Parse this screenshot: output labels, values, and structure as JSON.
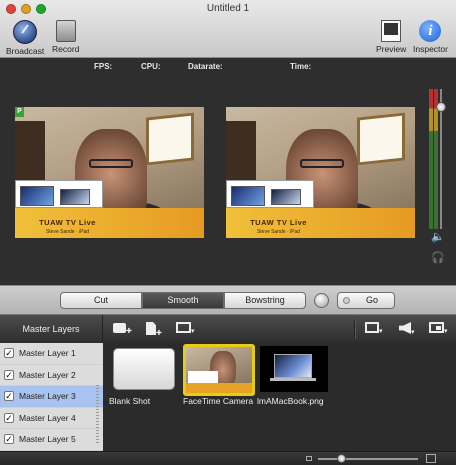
{
  "window": {
    "title": "Untitled 1"
  },
  "toolbar": {
    "broadcast_label": "Broadcast",
    "record_label": "Record",
    "preview_label": "Preview",
    "inspector_label": "Inspector",
    "icons": [
      "broadcast-icon",
      "record-icon",
      "preview-icon",
      "inspector-icon"
    ]
  },
  "stats": {
    "fps_label": "FPS:",
    "cpu_label": "CPU:",
    "datarate_label": "Datarate:",
    "time_label": "Time:"
  },
  "monitors": {
    "lower_third_title": "TUAW TV Live",
    "lower_third_subtitle": "Steve Sande · iPad",
    "program_badge": "P"
  },
  "switcher": {
    "transitions": [
      "Cut",
      "Smooth",
      "Bowstring"
    ],
    "selected_transition": "Smooth",
    "go_label": "Go"
  },
  "layers": {
    "header": "Master Layers",
    "items": [
      {
        "label": "Master Layer 1",
        "checked": true,
        "selected": false
      },
      {
        "label": "Master Layer 2",
        "checked": true,
        "selected": false
      },
      {
        "label": "Master Layer 3",
        "checked": true,
        "selected": true
      },
      {
        "label": "Master Layer 4",
        "checked": true,
        "selected": false
      },
      {
        "label": "Master Layer 5",
        "checked": true,
        "selected": false
      }
    ]
  },
  "sources": {
    "items": [
      {
        "label": "Blank Shot",
        "selected": false
      },
      {
        "label": "FaceTime Camera",
        "selected": true
      },
      {
        "label": "lmAMacBook.png",
        "selected": false
      }
    ]
  },
  "colors": {
    "selection_yellow": "#e6cb18",
    "selected_row": "#a9c3f0",
    "lower_third": "#f0c03a"
  }
}
